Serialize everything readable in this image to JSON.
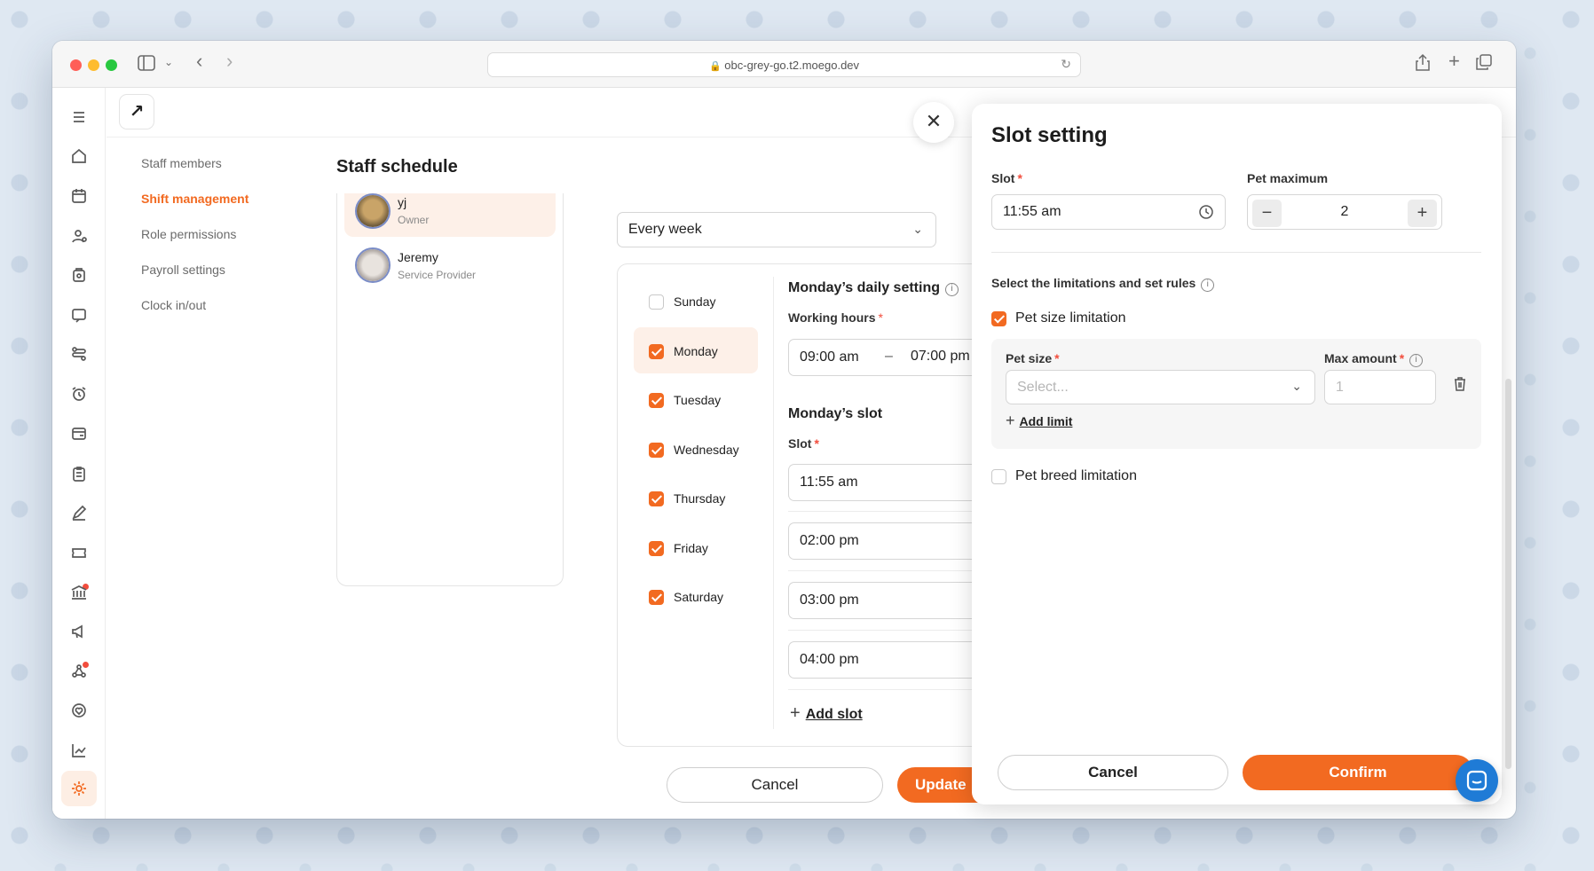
{
  "browser": {
    "url": "obc-grey-go.t2.moego.dev"
  },
  "subnav": {
    "items": [
      {
        "label": "Staff members"
      },
      {
        "label": "Shift management"
      },
      {
        "label": "Role permissions"
      },
      {
        "label": "Payroll settings"
      },
      {
        "label": "Clock in/out"
      }
    ]
  },
  "page": {
    "title": "Staff schedule"
  },
  "staff": [
    {
      "name": "yj",
      "role": "Owner"
    },
    {
      "name": "Jeremy",
      "role": "Service Provider"
    }
  ],
  "schedule": {
    "repeat": "Every week",
    "days": [
      {
        "label": "Sunday",
        "checked": false
      },
      {
        "label": "Monday",
        "checked": true
      },
      {
        "label": "Tuesday",
        "checked": true
      },
      {
        "label": "Wednesday",
        "checked": true
      },
      {
        "label": "Thursday",
        "checked": true
      },
      {
        "label": "Friday",
        "checked": true
      },
      {
        "label": "Saturday",
        "checked": true
      }
    ],
    "daily_title": "Monday’s daily setting",
    "working_hours_label": "Working hours",
    "start": "09:00 am",
    "dash": "–",
    "end": "07:00 pm",
    "slot_title": "Monday’s slot",
    "slot_label": "Slot",
    "slots": [
      "11:55 am",
      "02:00 pm",
      "03:00 pm",
      "04:00 pm"
    ],
    "add_slot": "Add slot"
  },
  "footer": {
    "cancel": "Cancel",
    "update": "Update"
  },
  "slot_setting": {
    "title": "Slot setting",
    "slot_label": "Slot",
    "slot_value": "11:55 am",
    "pet_max_label": "Pet maximum",
    "pet_max_value": "2",
    "limits_title": "Select the limitations and set rules",
    "pet_size_limit": {
      "label": "Pet size limitation",
      "checked": true
    },
    "pet_size_label": "Pet size",
    "pet_size_placeholder": "Select...",
    "max_amount_label": "Max amount",
    "max_amount_placeholder": "1",
    "add_limit": "Add limit",
    "pet_breed_limit": {
      "label": "Pet breed limitation",
      "checked": false
    },
    "cancel": "Cancel",
    "confirm": "Confirm"
  },
  "colors": {
    "accent": "#f26a21",
    "required": "#f24d3d",
    "chat": "#1f7bd6"
  },
  "icons": [
    "menu-icon",
    "home-icon",
    "calendar-icon",
    "client-icon",
    "booking-icon",
    "message-icon",
    "workflow-icon",
    "alarm-icon",
    "payment-icon",
    "clipboard-icon",
    "pen-icon",
    "ticket-icon",
    "bank-icon",
    "megaphone-icon",
    "network-icon",
    "heart-icon",
    "chart-icon",
    "settings-icon",
    "clock-icon",
    "trash-icon",
    "info-icon",
    "close-icon",
    "chat-icon"
  ]
}
